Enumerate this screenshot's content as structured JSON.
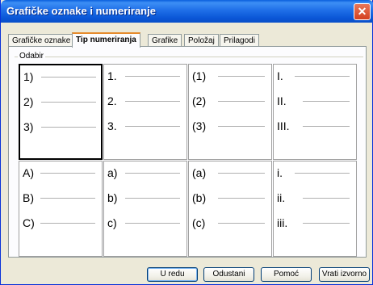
{
  "window": {
    "title": "Grafičke oznake i numeriranje",
    "close_glyph": "✕"
  },
  "tabs": [
    {
      "label": "Grafičke oznake",
      "active": false
    },
    {
      "label": "Tip numeriranja",
      "active": true
    },
    {
      "label": "Grafike",
      "active": false
    },
    {
      "label": "Položaj",
      "active": false
    },
    {
      "label": "Prilagodi",
      "active": false
    }
  ],
  "group": {
    "label": "Odabir"
  },
  "options": [
    {
      "items": [
        "1)",
        "2)",
        "3)"
      ]
    },
    {
      "items": [
        "1.",
        "2.",
        "3."
      ]
    },
    {
      "items": [
        "(1)",
        "(2)",
        "(3)"
      ]
    },
    {
      "items": [
        "I.",
        "II.",
        "III."
      ]
    },
    {
      "items": [
        "A)",
        "B)",
        "C)"
      ]
    },
    {
      "items": [
        "a)",
        "b)",
        "c)"
      ]
    },
    {
      "items": [
        "(a)",
        "(b)",
        "(c)"
      ]
    },
    {
      "items": [
        "i.",
        "ii.",
        "iii."
      ]
    }
  ],
  "buttons": {
    "ok": "U redu",
    "cancel": "Odustani",
    "help": "Pomoć",
    "reset": "Vrati izvorno"
  }
}
